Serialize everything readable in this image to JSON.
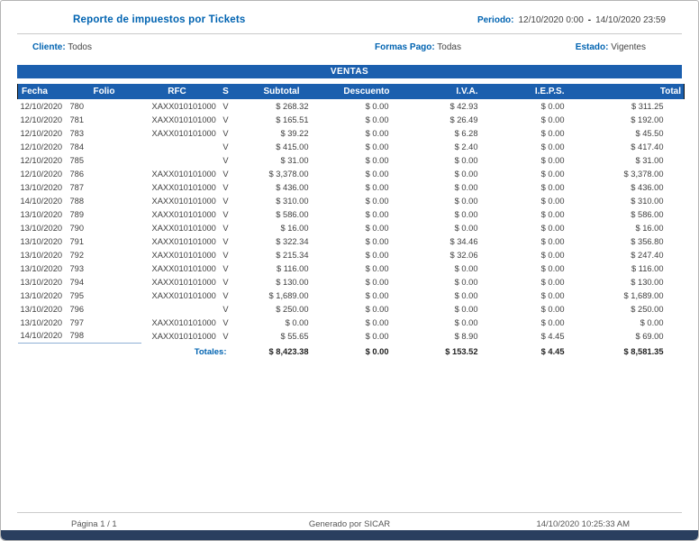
{
  "colors": {
    "accent": "#0063b1",
    "tableheader": "#1b5fae",
    "bottombar": "#2a3f5f"
  },
  "report": {
    "title": "Reporte de impuestos por Tickets",
    "periodo": {
      "label": "Periodo:",
      "from": "12/10/2020 0:00",
      "dash": "-",
      "to": "14/10/2020 23:59"
    },
    "filters": {
      "cliente_label": "Cliente:",
      "cliente_value": "Todos",
      "formas_label": "Formas Pago:",
      "formas_value": "Todas",
      "estado_label": "Estado:",
      "estado_value": "Vigentes"
    },
    "section": "VENTAS",
    "columns": [
      "Fecha",
      "Folio",
      "RFC",
      "S",
      "Subtotal",
      "Descuento",
      "I.V.A.",
      "I.E.P.S.",
      "Total"
    ],
    "rows": [
      [
        "12/10/2020",
        "780",
        "XAXX010101000",
        "V",
        "$ 268.32",
        "$ 0.00",
        "$ 42.93",
        "$ 0.00",
        "$ 311.25"
      ],
      [
        "12/10/2020",
        "781",
        "XAXX010101000",
        "V",
        "$ 165.51",
        "$ 0.00",
        "$ 26.49",
        "$ 0.00",
        "$ 192.00"
      ],
      [
        "12/10/2020",
        "783",
        "XAXX010101000",
        "V",
        "$ 39.22",
        "$ 0.00",
        "$ 6.28",
        "$ 0.00",
        "$ 45.50"
      ],
      [
        "12/10/2020",
        "784",
        "",
        "V",
        "$ 415.00",
        "$ 0.00",
        "$ 2.40",
        "$ 0.00",
        "$ 417.40"
      ],
      [
        "12/10/2020",
        "785",
        "",
        "V",
        "$ 31.00",
        "$ 0.00",
        "$ 0.00",
        "$ 0.00",
        "$ 31.00"
      ],
      [
        "12/10/2020",
        "786",
        "XAXX010101000",
        "V",
        "$ 3,378.00",
        "$ 0.00",
        "$ 0.00",
        "$ 0.00",
        "$ 3,378.00"
      ],
      [
        "13/10/2020",
        "787",
        "XAXX010101000",
        "V",
        "$ 436.00",
        "$ 0.00",
        "$ 0.00",
        "$ 0.00",
        "$ 436.00"
      ],
      [
        "14/10/2020",
        "788",
        "XAXX010101000",
        "V",
        "$ 310.00",
        "$ 0.00",
        "$ 0.00",
        "$ 0.00",
        "$ 310.00"
      ],
      [
        "13/10/2020",
        "789",
        "XAXX010101000",
        "V",
        "$ 586.00",
        "$ 0.00",
        "$ 0.00",
        "$ 0.00",
        "$ 586.00"
      ],
      [
        "13/10/2020",
        "790",
        "XAXX010101000",
        "V",
        "$ 16.00",
        "$ 0.00",
        "$ 0.00",
        "$ 0.00",
        "$ 16.00"
      ],
      [
        "13/10/2020",
        "791",
        "XAXX010101000",
        "V",
        "$ 322.34",
        "$ 0.00",
        "$ 34.46",
        "$ 0.00",
        "$ 356.80"
      ],
      [
        "13/10/2020",
        "792",
        "XAXX010101000",
        "V",
        "$ 215.34",
        "$ 0.00",
        "$ 32.06",
        "$ 0.00",
        "$ 247.40"
      ],
      [
        "13/10/2020",
        "793",
        "XAXX010101000",
        "V",
        "$ 116.00",
        "$ 0.00",
        "$ 0.00",
        "$ 0.00",
        "$ 116.00"
      ],
      [
        "13/10/2020",
        "794",
        "XAXX010101000",
        "V",
        "$ 130.00",
        "$ 0.00",
        "$ 0.00",
        "$ 0.00",
        "$ 130.00"
      ],
      [
        "13/10/2020",
        "795",
        "XAXX010101000",
        "V",
        "$ 1,689.00",
        "$ 0.00",
        "$ 0.00",
        "$ 0.00",
        "$ 1,689.00"
      ],
      [
        "13/10/2020",
        "796",
        "",
        "V",
        "$ 250.00",
        "$ 0.00",
        "$ 0.00",
        "$ 0.00",
        "$ 250.00"
      ],
      [
        "13/10/2020",
        "797",
        "XAXX010101000",
        "V",
        "$ 0.00",
        "$ 0.00",
        "$ 0.00",
        "$ 0.00",
        "$ 0.00"
      ],
      [
        "14/10/2020",
        "798",
        "XAXX010101000",
        "V",
        "$ 55.65",
        "$ 0.00",
        "$ 8.90",
        "$ 4.45",
        "$ 69.00"
      ]
    ],
    "totals": {
      "label": "Totales:",
      "values": [
        "$ 8,423.38",
        "$ 0.00",
        "$ 153.52",
        "$ 4.45",
        "$ 8,581.35"
      ]
    },
    "footer": {
      "page": "Página 1 / 1",
      "generated": "Generado por SICAR",
      "timestamp": "14/10/2020 10:25:33 AM"
    }
  }
}
